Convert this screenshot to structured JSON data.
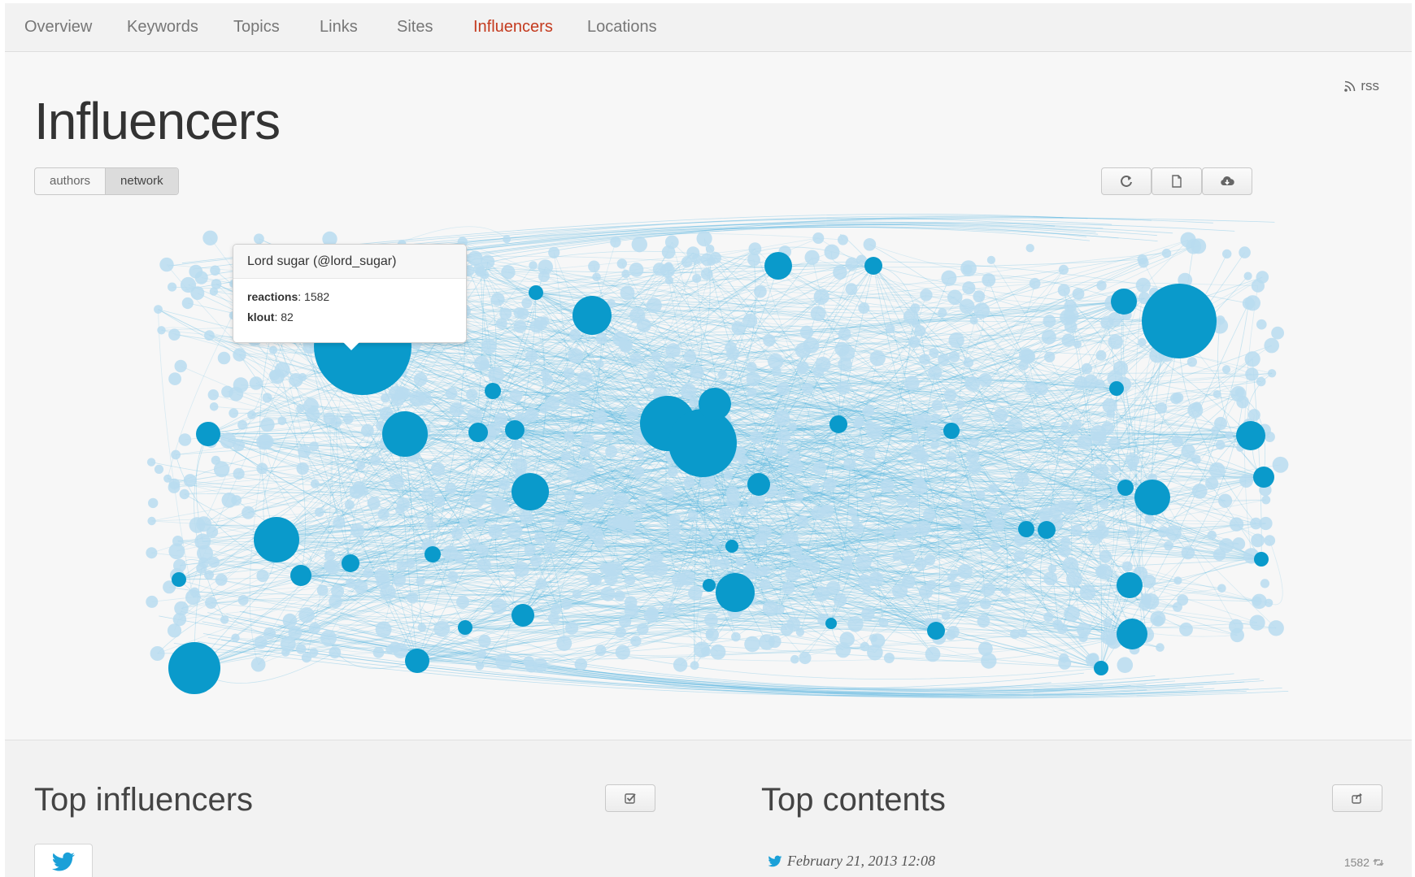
{
  "nav": {
    "items": [
      {
        "label": "Overview"
      },
      {
        "label": "Keywords"
      },
      {
        "label": "Topics"
      },
      {
        "label": "Links"
      },
      {
        "label": "Sites"
      },
      {
        "label": "Influencers",
        "active": true
      },
      {
        "label": "Locations"
      }
    ]
  },
  "header": {
    "rss_label": "rss",
    "title": "Influencers"
  },
  "view_toggle": {
    "options": [
      {
        "label": "authors"
      },
      {
        "label": "network",
        "selected": true
      }
    ]
  },
  "toolbar": {
    "icons": [
      "refresh-icon",
      "document-icon",
      "cloud-download-icon"
    ]
  },
  "tooltip": {
    "title": "Lord sugar (@lord_sugar)",
    "reactions_label": "reactions",
    "reactions_value": "1582",
    "klout_label": "klout",
    "klout_value": "82"
  },
  "sections": {
    "top_influencers_title": "Top influencers",
    "top_contents_title": "Top contents"
  },
  "top_contents": {
    "first_date": "February 21, 2013 12:08",
    "first_count": "1582"
  },
  "colors": {
    "active_nav": "#c43b1f",
    "node_major": "#0a9acb",
    "node_minor": "#b8dcf0",
    "edge": "#4fb3df"
  }
}
